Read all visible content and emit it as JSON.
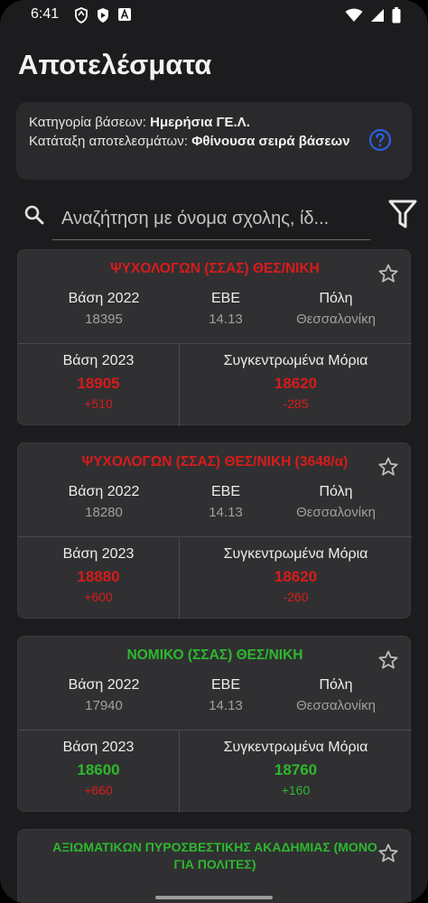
{
  "status": {
    "time": "6:41"
  },
  "header": {
    "title": "Αποτελέσματα"
  },
  "info": {
    "category_label": "Κατηγορία βάσεων:",
    "category_value": "Ημερήσια ΓΕ.Λ.",
    "sort_label": "Κατάταξη αποτελεσμάτων:",
    "sort_value": "Φθίνουσα σειρά βάσεων"
  },
  "search": {
    "placeholder": "Αναζήτηση με όνομα σχολης, ίδ..."
  },
  "labels": {
    "base2022": "Βάση 2022",
    "ebe": "ΕΒΕ",
    "city": "Πόλη",
    "base2023": "Βάση 2023",
    "points": "Συγκεντρωμένα Μόρια"
  },
  "results": [
    {
      "title": "ΨΥΧΟΛΟΓΩΝ (ΣΣΑΣ) ΘΕΣ/ΝΙΚΗ",
      "base2022": "18395",
      "ebe": "14.13",
      "city": "Θεσσαλονίκη",
      "base2023": "18905",
      "base_diff": "+510",
      "points": "18620",
      "points_diff": "-285",
      "color": "#d81b1b"
    },
    {
      "title": "ΨΥΧΟΛΟΓΩΝ (ΣΣΑΣ) ΘΕΣ/ΝΙΚΗ (3648/α)",
      "base2022": "18280",
      "ebe": "14.13",
      "city": "Θεσσαλονίκη",
      "base2023": "18880",
      "base_diff": "+600",
      "points": "18620",
      "points_diff": "-260",
      "color": "#d81b1b"
    },
    {
      "title": "ΝΟΜΙΚΟ (ΣΣΑΣ) ΘΕΣ/ΝΙΚΗ",
      "base2022": "17940",
      "ebe": "14.13",
      "city": "Θεσσαλονίκη",
      "base2023": "18600",
      "base_diff": "+660",
      "points": "18760",
      "points_diff": "+160",
      "color": "#2db82d"
    },
    {
      "title": "ΑΞΙΩΜΑΤΙΚΩΝ ΠΥΡΟΣΒΕΣΤΙΚΗΣ ΑΚΑΔΗΜΙΑΣ (ΜΟΝΟ ΓΙΑ ΠΟΛΙΤΕΣ)",
      "color": "#2db82d"
    }
  ]
}
